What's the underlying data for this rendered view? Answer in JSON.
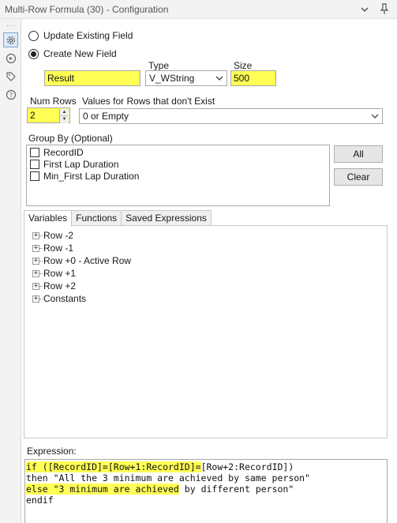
{
  "window": {
    "title": "Multi-Row Formula (30) - Configuration"
  },
  "sidebar": {
    "icons": [
      "gear-icon",
      "compass-icon",
      "tag-icon",
      "help-icon"
    ]
  },
  "mode": {
    "update_label": "Update Existing Field",
    "create_label": "Create New  Field",
    "selected": "create"
  },
  "field": {
    "name_value": "Result",
    "type_label": "Type",
    "type_value": "V_WString",
    "size_label": "Size",
    "size_value": "500"
  },
  "rows": {
    "num_rows_label": "Num Rows",
    "num_rows_value": "2",
    "values_label": "Values for Rows that don't Exist",
    "values_value": "0 or Empty"
  },
  "group_by": {
    "label": "Group By (Optional)",
    "items": [
      "RecordID",
      "First Lap Duration",
      "Min_First Lap Duration"
    ],
    "all_button": "All",
    "clear_button": "Clear"
  },
  "tabs": [
    "Variables",
    "Functions",
    "Saved Expressions"
  ],
  "tree": [
    "Row -2",
    "Row -1",
    "Row +0 - Active Row",
    "Row +1",
    "Row +2",
    "Constants"
  ],
  "expression": {
    "label": "Expression:",
    "line1_a": "if ([RecordID]=[Row+1:RecordID]=",
    "line1_b": "[Row+2:RecordID])",
    "line2_a": "then \"All the 3 minimum are achieved by same person\"",
    "line3_a": "else \"3 minimum are achieved",
    "line3_b": " by different person\"",
    "line4_a": "endif"
  },
  "colors": {
    "highlight": "#ffff55",
    "accent": "#7aa7d8"
  }
}
